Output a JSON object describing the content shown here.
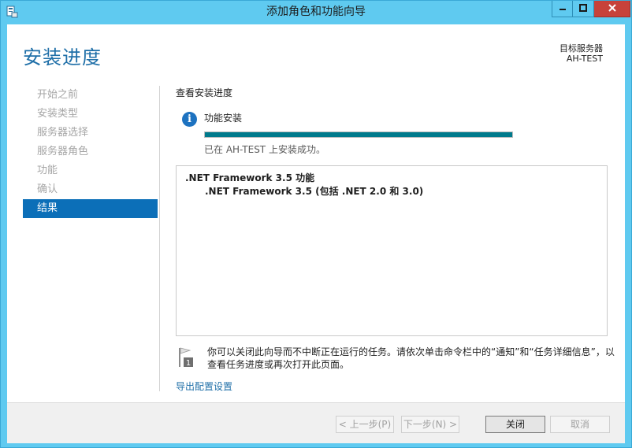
{
  "window": {
    "title": "添加角色和功能向导"
  },
  "header": {
    "page_title": "安装进度",
    "server_label": "目标服务器",
    "server_name": "AH-TEST"
  },
  "nav": {
    "items": [
      {
        "label": "开始之前",
        "active": false
      },
      {
        "label": "安装类型",
        "active": false
      },
      {
        "label": "服务器选择",
        "active": false
      },
      {
        "label": "服务器角色",
        "active": false
      },
      {
        "label": "功能",
        "active": false
      },
      {
        "label": "确认",
        "active": false
      },
      {
        "label": "结果",
        "active": true
      }
    ]
  },
  "content": {
    "section_label": "查看安装进度",
    "feature_label": "功能安装",
    "progress_fraction": 1.0,
    "status_text": "已在 AH-TEST 上安装成功。",
    "results": [
      ".NET Framework 3.5 功能",
      ".NET Framework 3.5 (包括 .NET 2.0 和 3.0)"
    ],
    "notice": "你可以关闭此向导而不中断正在运行的任务。请依次单击命令栏中的“通知”和“任务详细信息”，以查看任务进度或再次打开此页面。",
    "export_link": "导出配置设置"
  },
  "footer": {
    "prev_label": "< 上一步(P)",
    "next_label": "下一步(N) >",
    "close_label": "关闭",
    "cancel_label": "取消"
  },
  "colors": {
    "titlebar": "#5fcaf0",
    "accent": "#1f6fa8",
    "nav_active": "#0c6fb8",
    "progress": "#007a8c",
    "close_button": "#c7423a"
  },
  "icons": {
    "app": "server-manager-icon",
    "info": "info-icon",
    "notice": "flag-notification-icon"
  }
}
